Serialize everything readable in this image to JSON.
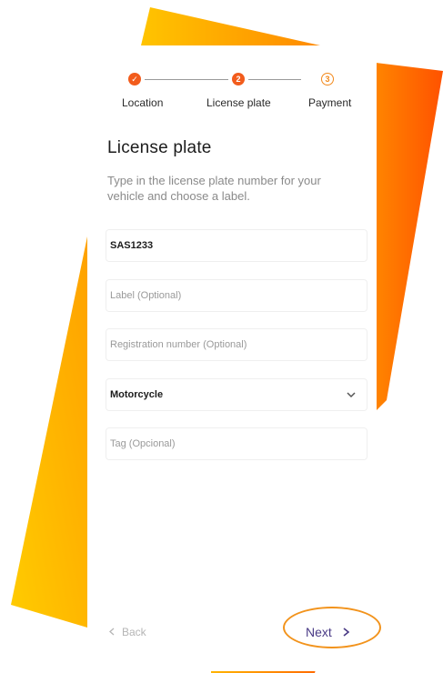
{
  "stepper": {
    "steps": [
      {
        "label": "Location",
        "status": "done",
        "marker": "✓"
      },
      {
        "label": "License plate",
        "status": "active",
        "marker": "2"
      },
      {
        "label": "Payment",
        "status": "pending",
        "marker": "3"
      }
    ]
  },
  "page": {
    "title": "License plate",
    "subtitle": "Type in the license plate number for your vehicle and choose a label."
  },
  "form": {
    "plate_value": "SAS1233",
    "label_placeholder": "Label (Optional)",
    "registration_placeholder": "Registration number (Optional)",
    "vehicle_type_value": "Motorcycle",
    "tag_placeholder": "Tag (Opcional)"
  },
  "footer": {
    "back_label": "Back",
    "next_label": "Next"
  },
  "icons": {
    "check": "check-icon",
    "back": "chevron-left-icon",
    "next": "chevron-right-icon",
    "dropdown": "chevron-down-icon"
  },
  "colors": {
    "accent_orange": "#f25c1c",
    "accent_yellow": "#ffc400",
    "next_text": "#4a3b86",
    "highlight_ring": "#f2931c"
  }
}
